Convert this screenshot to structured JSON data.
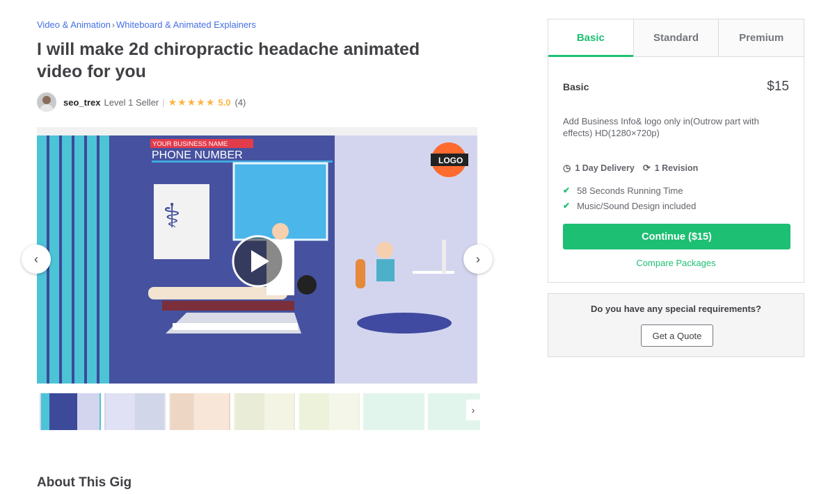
{
  "breadcrumb": {
    "items": [
      "Video & Animation",
      "Whiteboard & Animated Explainers"
    ],
    "separator": "›"
  },
  "gig": {
    "title": "I will make 2d chiropractic headache animated video for you"
  },
  "seller": {
    "name": "seo_trex",
    "level": "Level 1 Seller",
    "separator": "|",
    "stars": "★★★★★",
    "rating": "5.0",
    "review_count": "(4)"
  },
  "gallery": {
    "image_business_name": "YOUR BUSINESS NAME",
    "image_phone": "PHONE NUMBER",
    "image_logo": "LOGO",
    "prev_icon": "chevron-left-icon",
    "next_icon": "chevron-right-icon",
    "play_icon": "play-icon",
    "thumbnail_count": 7,
    "active_thumbnail": 1
  },
  "about": {
    "heading": "About This Gig"
  },
  "package": {
    "tabs": [
      {
        "label": "Basic",
        "active": true
      },
      {
        "label": "Standard",
        "active": false
      },
      {
        "label": "Premium",
        "active": false
      }
    ],
    "name": "Basic",
    "price": "$15",
    "description": "Add Business Info& logo only in(Outrow part with effects) HD(1280×720p)",
    "delivery": "1 Day Delivery",
    "revisions": "1 Revision",
    "features": [
      "58 Seconds Running Time",
      "Music/Sound Design included"
    ],
    "continue_label": "Continue ($15)",
    "compare_label": "Compare Packages"
  },
  "quote": {
    "question": "Do you have any special requirements?",
    "button_label": "Get a Quote"
  },
  "colors": {
    "accent": "#1dbf73",
    "link": "#446ee7",
    "star": "#ffb33e",
    "text": "#404145"
  }
}
